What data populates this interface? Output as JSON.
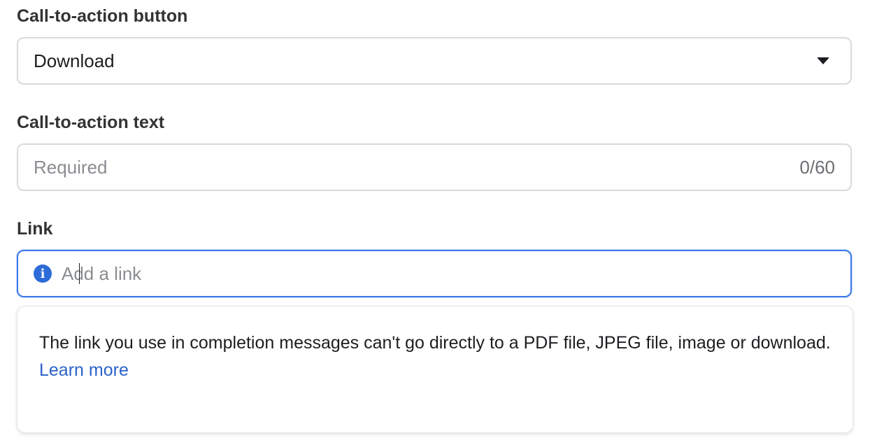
{
  "cta_button": {
    "label": "Call-to-action button",
    "selected": "Download"
  },
  "cta_text": {
    "label": "Call-to-action text",
    "placeholder": "Required",
    "value": "",
    "counter": "0/60"
  },
  "link": {
    "label": "Link",
    "placeholder": "Add a link",
    "value": ""
  },
  "tooltip": {
    "message": "The link you use in completion messages can't go directly to a PDF file, JPEG file, image or download.",
    "learn_more": "Learn more"
  },
  "colors": {
    "accent": "#3b78e7",
    "link": "#2a62c9",
    "info_icon": "#2d6bd8"
  },
  "icons": {
    "select_caret": "chevron-down-icon",
    "link_info": "info-icon"
  }
}
